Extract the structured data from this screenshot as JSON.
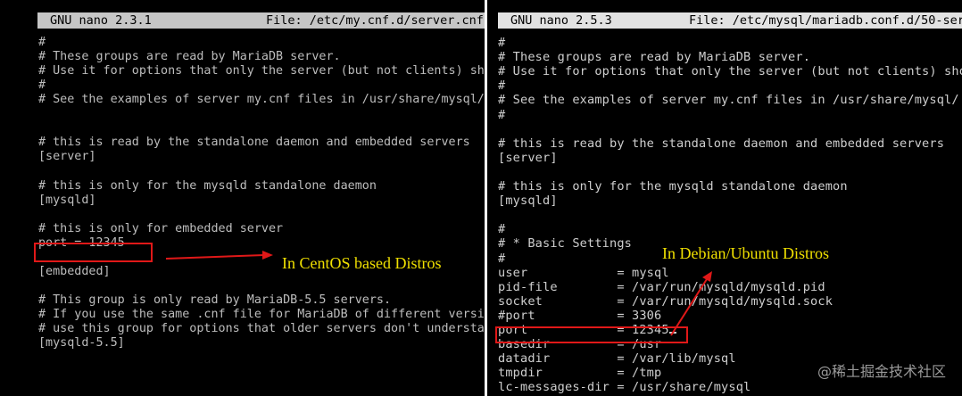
{
  "left": {
    "title_app": "GNU nano 2.3.1",
    "title_file": "File: /etc/my.cnf.d/server.cnf",
    "lines": [
      "#",
      "# These groups are read by MariaDB server.",
      "# Use it for options that only the server (but not clients) sho",
      "#",
      "# See the examples of server my.cnf files in /usr/share/mysql/",
      "",
      "",
      "# this is read by the standalone daemon and embedded servers",
      "[server]",
      "",
      "# this is only for the mysqld standalone daemon",
      "[mysqld]",
      "",
      "# this is only for embedded server",
      "port = 12345",
      "",
      "[embedded]",
      "",
      "# This group is only read by MariaDB-5.5 servers.",
      "# If you use the same .cnf file for MariaDB of different versic",
      "# use this group for options that older servers don't understar",
      "[mysqld-5.5]"
    ],
    "annotation": "In CentOS based Distros"
  },
  "right": {
    "title_app": "GNU nano 2.5.3",
    "title_file": "File: /etc/mysql/mariadb.conf.d/50-ser",
    "lines": [
      "#",
      "# These groups are read by MariaDB server.",
      "# Use it for options that only the server (but not clients) shoul",
      "#",
      "# See the examples of server my.cnf files in /usr/share/mysql/",
      "#",
      "",
      "# this is read by the standalone daemon and embedded servers",
      "[server]",
      "",
      "# this is only for the mysqld standalone daemon",
      "[mysqld]",
      "",
      "#",
      "# * Basic Settings",
      "#",
      "user            = mysql",
      "pid-file        = /var/run/mysqld/mysqld.pid",
      "socket          = /var/run/mysqld/mysqld.sock",
      "#port           = 3306",
      "port            = 12345",
      "basedir         = /usr",
      "datadir         = /var/lib/mysql",
      "tmpdir          = /tmp",
      "lc-messages-dir = /usr/share/mysql"
    ],
    "annotation": "In Debian/Ubuntu Distros"
  },
  "watermark": "@稀土掘金技术社区",
  "colors": {
    "terminal_bg": "#000000",
    "highlight": "#e01818",
    "annotation": "#f0e000"
  }
}
